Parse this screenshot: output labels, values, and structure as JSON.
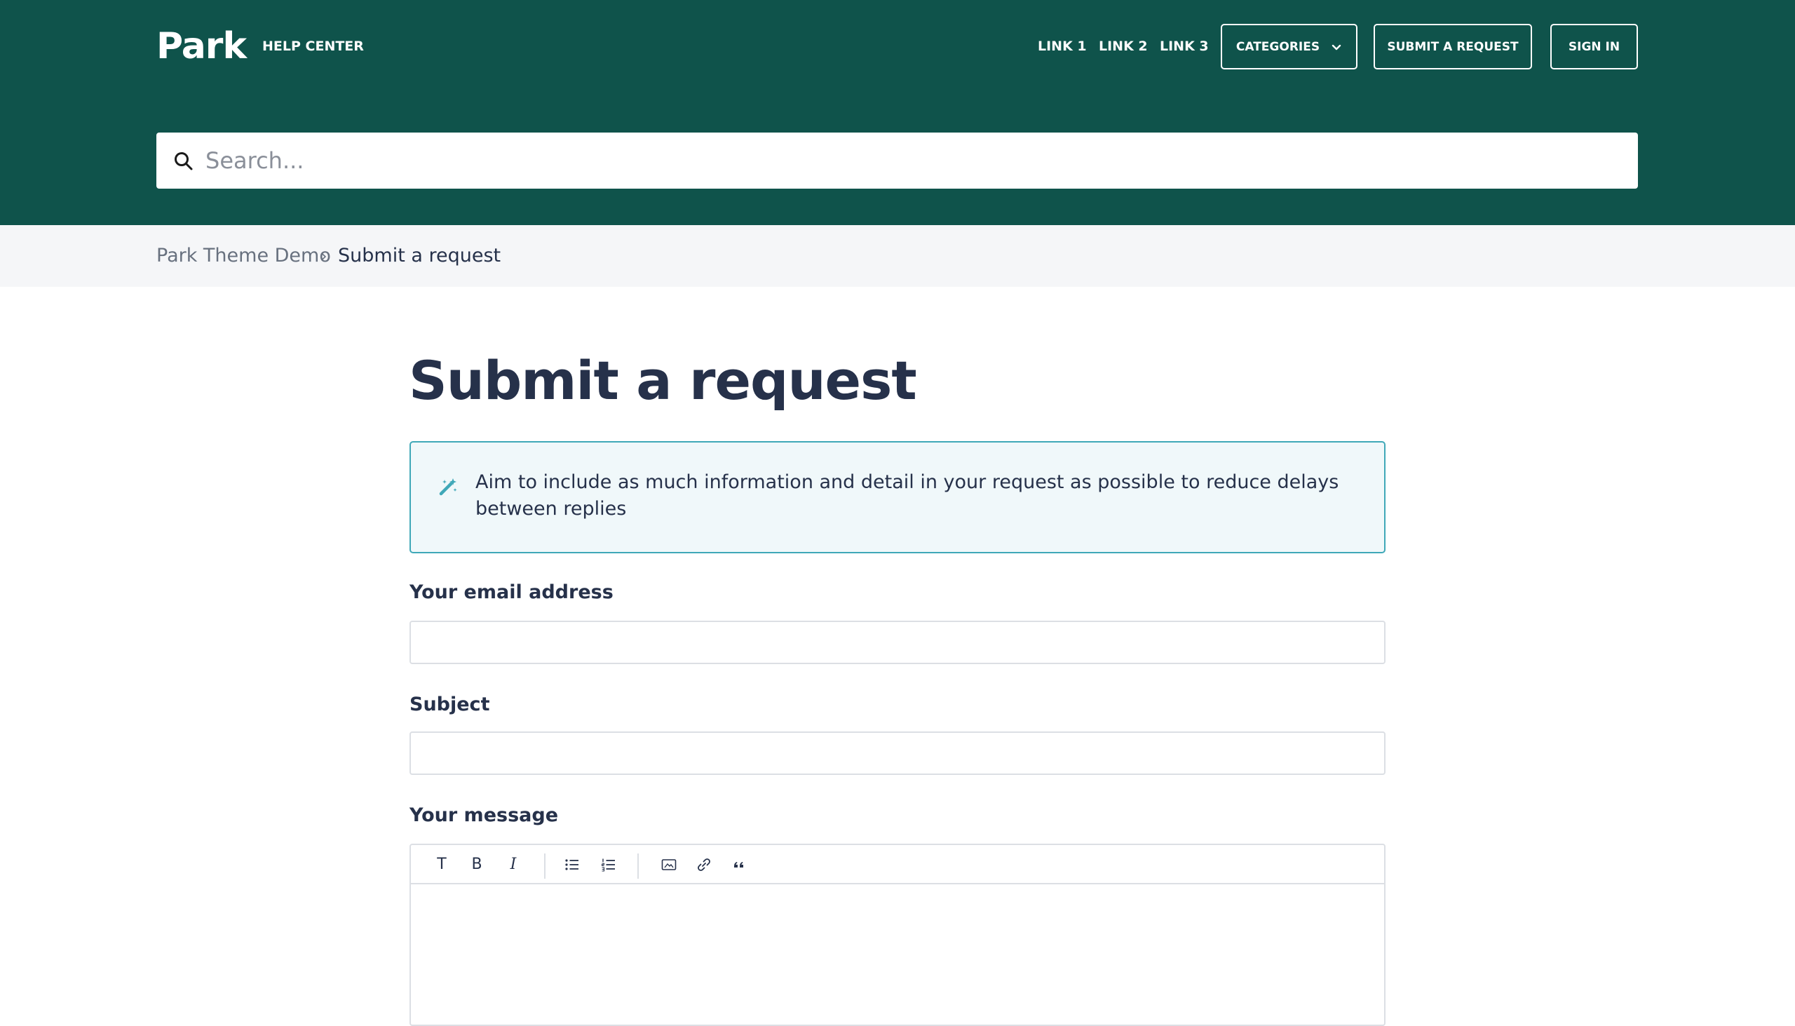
{
  "header": {
    "logo": "Park",
    "subtitle": "HELP CENTER",
    "links": [
      "LINK 1",
      "LINK 2",
      "LINK 3"
    ],
    "categories_label": "CATEGORIES",
    "submit_label": "SUBMIT A REQUEST",
    "signin_label": "SIGN IN",
    "bg_color": "#0f534b"
  },
  "search": {
    "placeholder": "Search..."
  },
  "breadcrumb": {
    "items": [
      "Park Theme Demo",
      "Submit a request"
    ],
    "separator": "›"
  },
  "main": {
    "title": "Submit a request",
    "notice": "Aim to include as much information and detail in your request as possible to reduce delays between replies",
    "notice_icon": "magic-wand-icon",
    "accent_color": "#3fa8b8",
    "fields": {
      "email_label": "Your email address",
      "email_value": "",
      "subject_label": "Subject",
      "subject_value": "",
      "message_label": "Your message"
    },
    "editor_toolbar": {
      "text_label": "T",
      "bold_label": "B",
      "italic_label": "I",
      "icons": [
        "text-style-icon",
        "bold-icon",
        "italic-icon",
        "bulleted-list-icon",
        "numbered-list-icon",
        "image-icon",
        "link-icon",
        "quote-icon"
      ]
    }
  }
}
